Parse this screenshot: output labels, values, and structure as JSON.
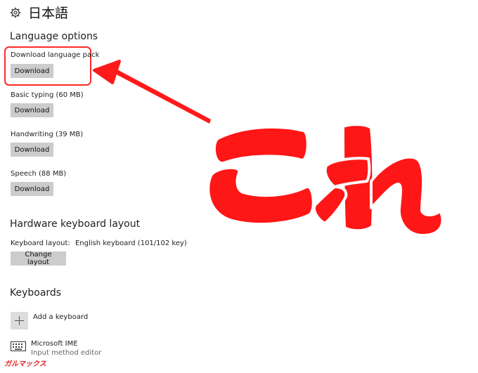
{
  "header": {
    "title": "日本語",
    "icon": "gear-icon"
  },
  "language_options": {
    "heading": "Language options",
    "items": [
      {
        "label": "Download language pack",
        "button": "Download"
      },
      {
        "label": "Basic typing (60 MB)",
        "button": "Download"
      },
      {
        "label": "Handwriting (39 MB)",
        "button": "Download"
      },
      {
        "label": "Speech (88 MB)",
        "button": "Download"
      }
    ]
  },
  "hardware_keyboard": {
    "heading": "Hardware keyboard layout",
    "layout_label": "Keyboard layout:",
    "layout_value": "English keyboard (101/102 key)",
    "change_button": "Change layout"
  },
  "keyboards": {
    "heading": "Keyboards",
    "add_label": "Add a keyboard",
    "ime_name": "Microsoft IME",
    "ime_desc": "Input method editor"
  },
  "annotation": {
    "text": "これ",
    "color": "#ff1a1a"
  },
  "watermark": {
    "text": "ガルマックス"
  },
  "colors": {
    "button_bg": "#cccccc",
    "highlight": "#ff2a2a",
    "add_bg": "#dcdcdc"
  }
}
